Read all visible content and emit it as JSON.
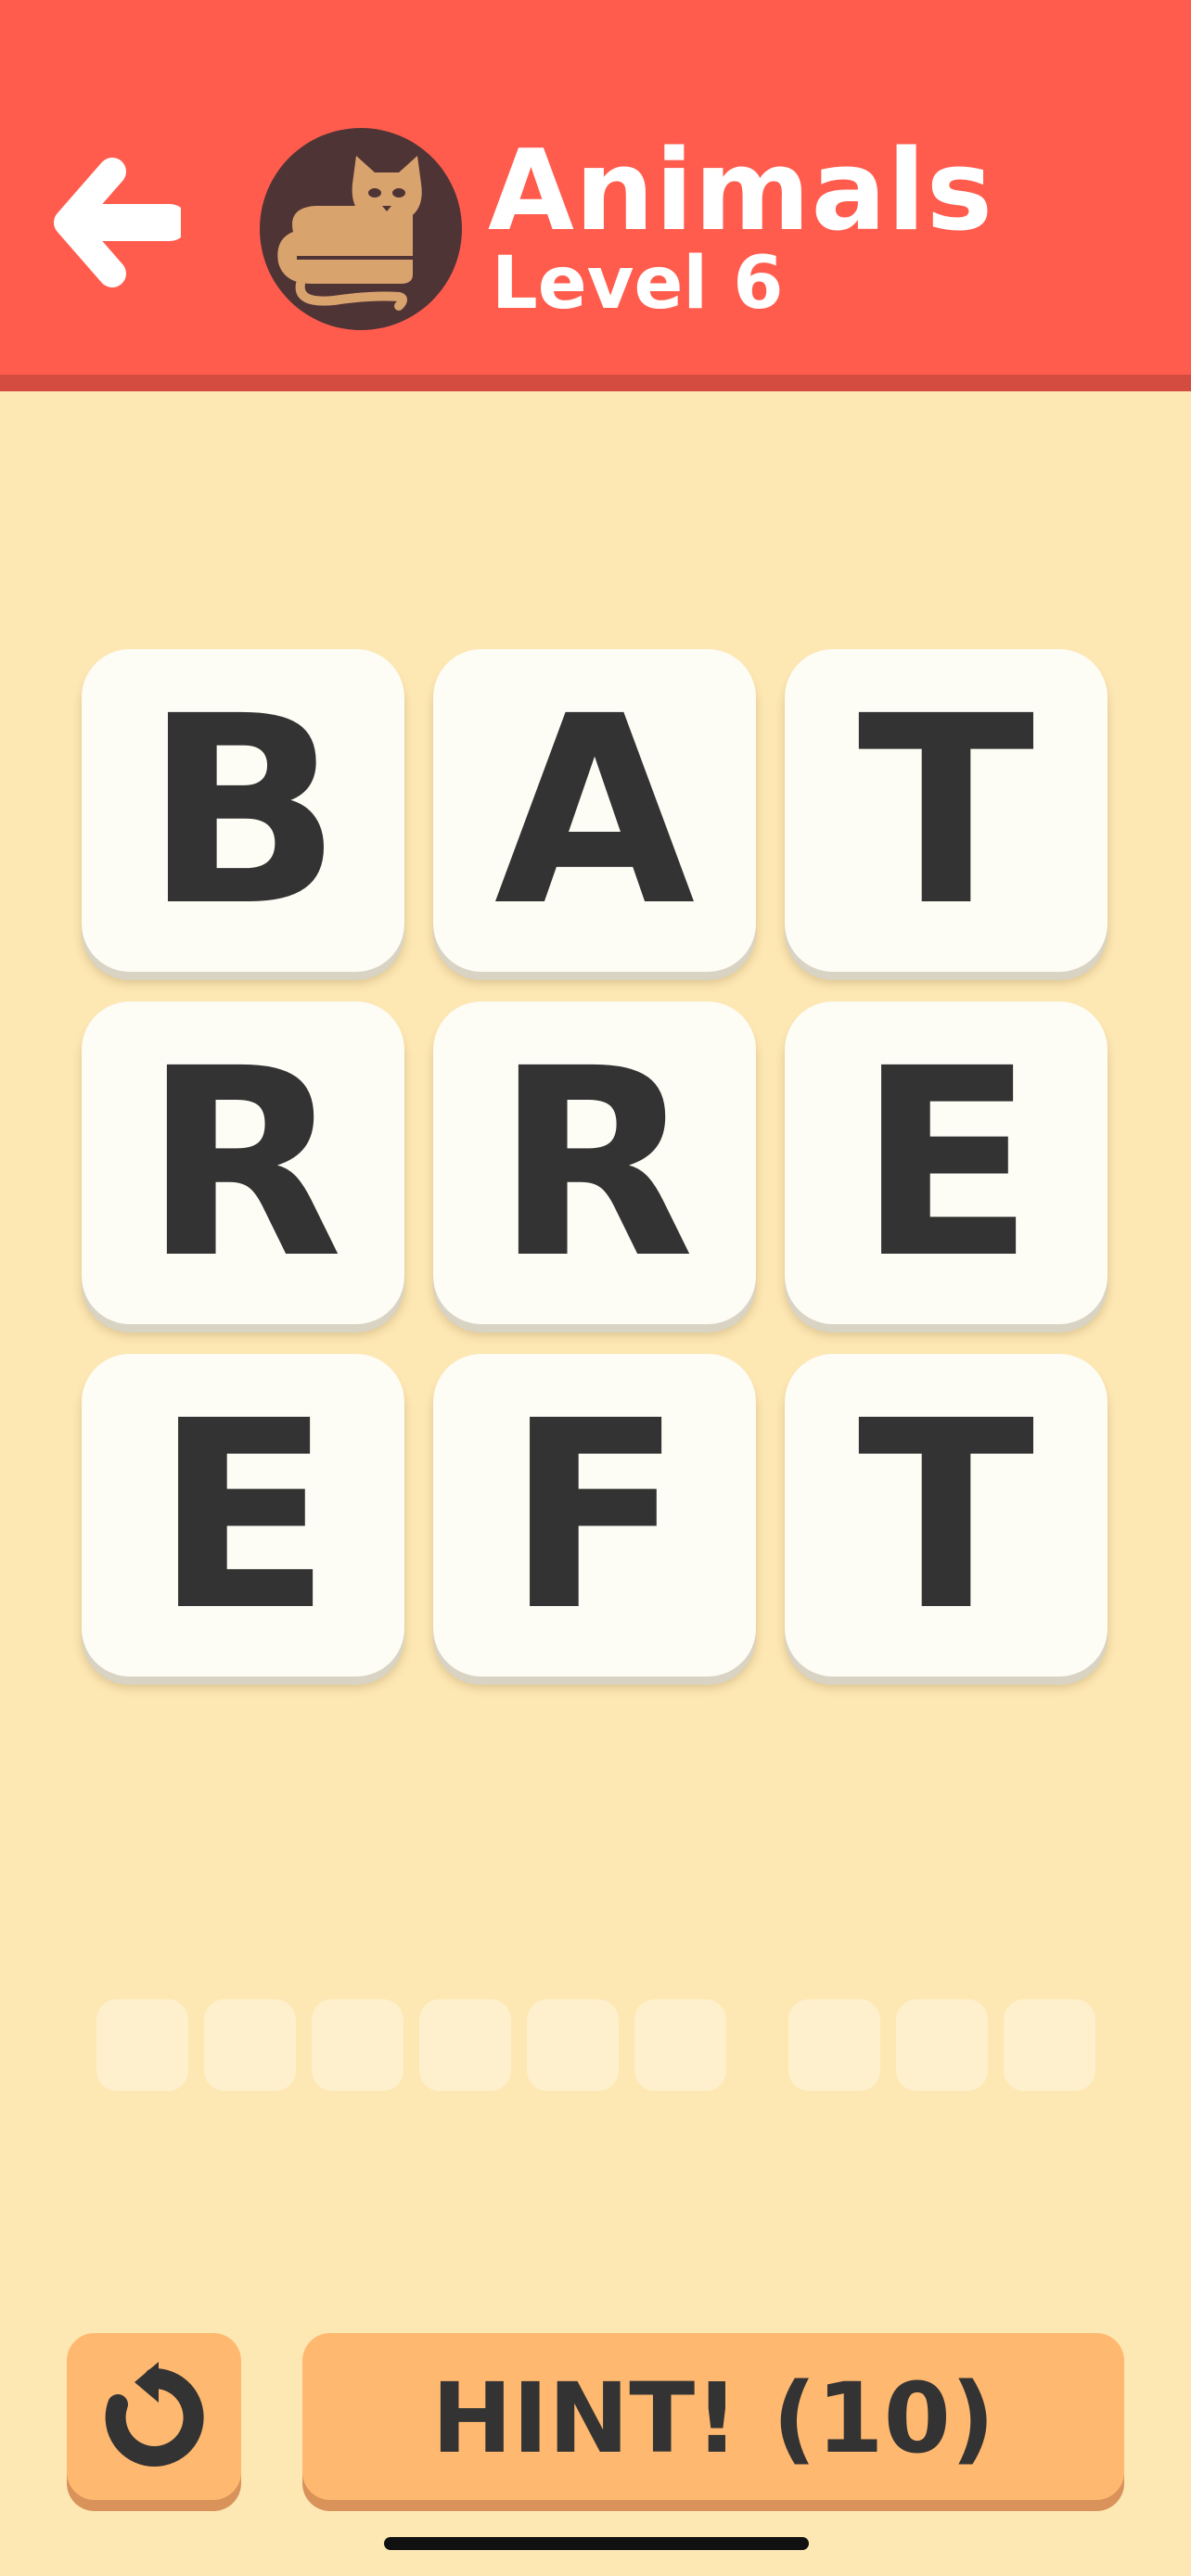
{
  "header": {
    "title": "Animals",
    "subtitle": "Level 6",
    "back_icon": "arrow-left-icon",
    "category_icon": "cat-icon",
    "colors": {
      "background": "#ff5c4d",
      "avatar": "#4f3436",
      "cat": "#d9a36e"
    }
  },
  "board": {
    "tiles": [
      "B",
      "A",
      "T",
      "R",
      "R",
      "E",
      "E",
      "F",
      "T"
    ]
  },
  "answer": {
    "words": [
      6,
      3
    ]
  },
  "controls": {
    "reset_icon": "restart-icon",
    "hint_label": "HINT! (10)"
  },
  "colors": {
    "background": "#fde7b3",
    "tile": "#fdfcf5",
    "letter": "#333333",
    "button": "#ffb86f"
  }
}
